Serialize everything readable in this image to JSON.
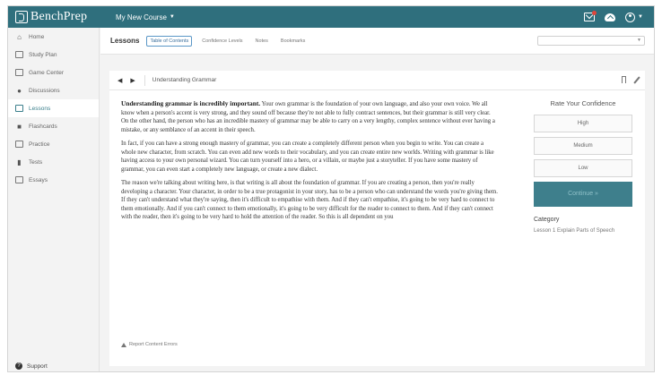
{
  "app": {
    "logo_text": "BenchPrep",
    "course_selector": "My New Course",
    "caret": "▼"
  },
  "sidebar": {
    "items": [
      {
        "label": "Home",
        "icon": "home-icon"
      },
      {
        "label": "Study Plan",
        "icon": "study-plan-icon"
      },
      {
        "label": "Game Center",
        "icon": "game-center-icon"
      },
      {
        "label": "Discussions",
        "icon": "discussions-icon"
      },
      {
        "label": "Lessons",
        "icon": "lessons-icon",
        "active": true
      },
      {
        "label": "Flashcards",
        "icon": "flashcards-icon"
      },
      {
        "label": "Practice",
        "icon": "practice-icon"
      },
      {
        "label": "Tests",
        "icon": "tests-icon"
      },
      {
        "label": "Essays",
        "icon": "essays-icon"
      }
    ],
    "support_label": "Support"
  },
  "lessons_bar": {
    "title": "Lessons",
    "tabs": [
      "Table of Contents",
      "Confidence Levels",
      "Notes",
      "Bookmarks"
    ],
    "active_tab": "Table of Contents"
  },
  "lesson": {
    "breadcrumb": "Understanding Grammar",
    "prev_arrow": "◀",
    "next_arrow": "▶",
    "lead": "Understanding grammar is incredibly important.",
    "p1_rest": " Your own grammar is the foundation of your own language, and also your own voice. We all know when a person's accent is very strong, and they sound off because they're not able to fully contract sentences, but their grammar is still very clear. On the other hand, the person who has an incredible mastery of grammar may be able to carry on a very lengthy, complex sentence without ever having a mistake, or any semblance of an accent in their speech.",
    "p2": "In fact, if you can have a strong enough mastery of grammar, you can create a completely different person when you begin to write. You can create a whole new character, from scratch. You can even add new words to their vocabulary, and you can create entire new worlds. Writing with grammar is like having access to your own personal wizard. You can turn yourself into a hero, or a villain, or maybe just a storyteller. If you have some mastery of grammar, you can even start a completely new language, or create a new dialect.",
    "p3": "The reason we're talking about writing here, is that writing is all about the foundation of grammar. If you are creating a person, then you're really developing a character. Your character, in order to be a true protagonist in your story, has to be a person who can understand the words you're giving them. If they can't understand what they're saying, then it's difficult to empathise with them. And if they can't empathise, it's going to be very hard to connect to them emotionally. And if you can't connect to them emotionally, it's going to be very difficult for the reader to connect to them. And if they can't connect with the reader, then it's going to be very hard to hold the attention of the reader. So this is all dependent on you",
    "report_label": "Report Content Errors"
  },
  "confidence": {
    "title": "Rate Your Confidence",
    "options": [
      "High",
      "Medium",
      "Low"
    ],
    "continue_label": "Continue »",
    "category_label": "Category",
    "category_value": "Lesson 1 Explain Parts of Speech"
  },
  "colors": {
    "brand": "#2f6f7d",
    "continue": "#3e7f8c",
    "active_nav_text": "#3b7f8c",
    "notification": "#e0463c"
  }
}
